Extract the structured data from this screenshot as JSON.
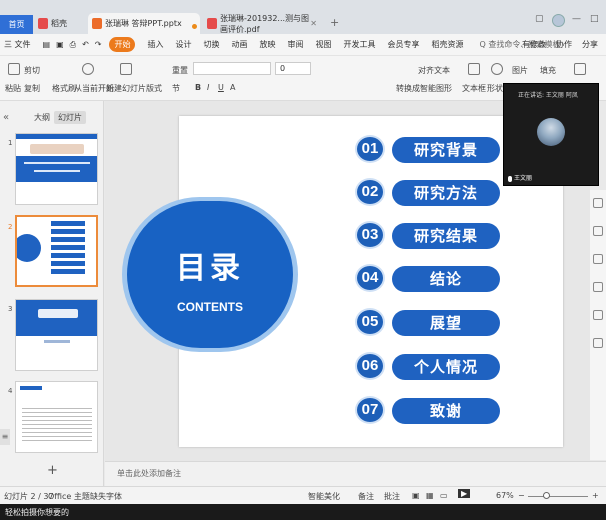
{
  "tabs": {
    "home_label": "首页",
    "tab1": "稻壳",
    "tab2": "张瑞琳 答辩PPT.pptx",
    "tab3": "张瑞琳-201932...测与图画评价.pdf"
  },
  "menu": {
    "file": "三 文件",
    "items": [
      "开始",
      "插入",
      "设计",
      "切换",
      "动画",
      "放映",
      "审阅",
      "视图",
      "开发工具",
      "会员专享",
      "稻壳资源"
    ],
    "active_index": 0,
    "search": "Q 查找命令、搜索模板",
    "right": [
      "有修改",
      "协作",
      "分享"
    ]
  },
  "ribbon": {
    "paste": "粘贴",
    "cut": "剪切",
    "copy": "复制",
    "format_painter": "格式刷",
    "from_start": "从当前开始",
    "new_slide": "新建幻灯片",
    "layout": "版式",
    "section": "节",
    "reset": "重置",
    "font_size": "0",
    "align_text": "对齐文本",
    "convert_smartart": "转换成智能图形",
    "textbox": "文本框",
    "shape": "形状",
    "arrange": "排列",
    "picture": "图片",
    "fill": "填充"
  },
  "left_panel": {
    "tab_outline": "大纲",
    "tab_slides": "幻灯片",
    "slide_numbers": [
      "1",
      "2",
      "3",
      "4"
    ],
    "current_index": 1,
    "add": "+"
  },
  "slide": {
    "title": "目录",
    "subtitle": "CONTENTS",
    "items": [
      {
        "num": "01",
        "label": "研究背景"
      },
      {
        "num": "02",
        "label": "研究方法"
      },
      {
        "num": "03",
        "label": "研究结果"
      },
      {
        "num": "04",
        "label": "结论"
      },
      {
        "num": "05",
        "label": "展望"
      },
      {
        "num": "06",
        "label": "个人情况"
      },
      {
        "num": "07",
        "label": "致谢"
      }
    ]
  },
  "notes": {
    "placeholder": "单击此处添加备注"
  },
  "status": {
    "slide_counter": "幻灯片 2 / 37",
    "theme": "Office 主题",
    "missing_font": "缺失字体",
    "smart_beautify": "智能美化",
    "notes_btn": "备注",
    "comments_btn": "批注",
    "zoom": "67%"
  },
  "bottom_bar": {
    "text": "轻松拍摄你想要的"
  },
  "video": {
    "top_text": "正在讲话: 王文丽 阿凤",
    "name": "王文丽"
  }
}
